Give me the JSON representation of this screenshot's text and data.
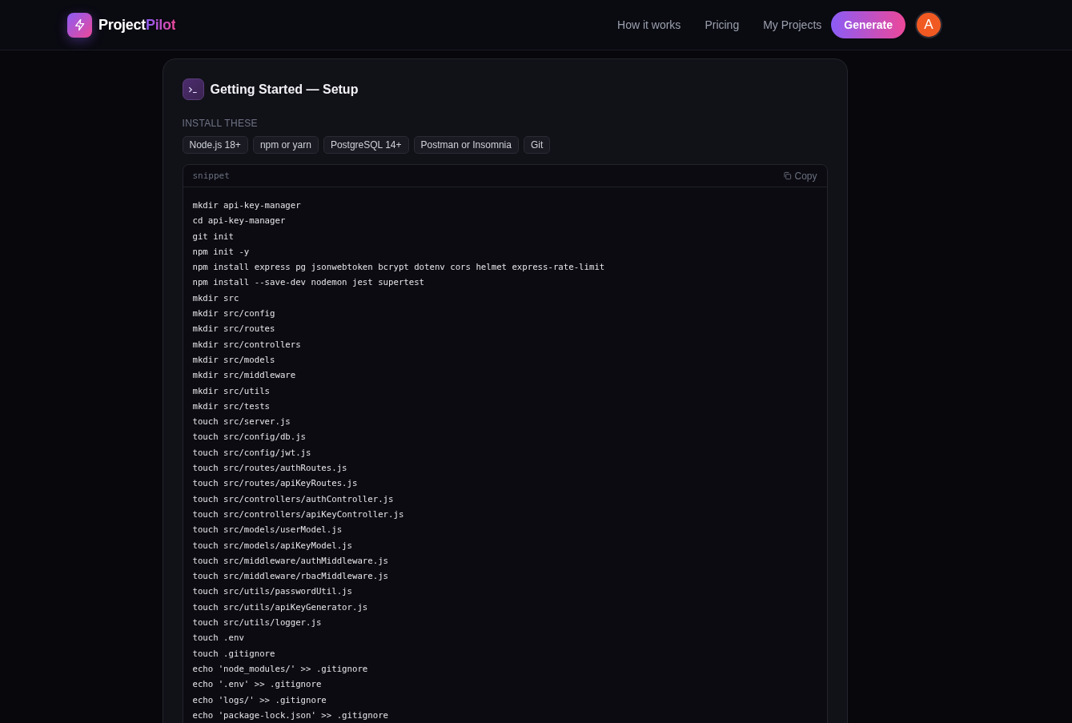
{
  "brand": {
    "name": "Project",
    "accent": "Pilot"
  },
  "nav": [
    {
      "label": "How it works"
    },
    {
      "label": "Pricing"
    },
    {
      "label": "My Projects"
    }
  ],
  "cta": {
    "label": "Generate"
  },
  "avatar": {
    "initial": "A"
  },
  "section": {
    "title": "Getting Started — Setup",
    "install_label": "INSTALL THESE",
    "tools": [
      "Node.js 18+",
      "npm or yarn",
      "PostgreSQL 14+",
      "Postman or Insomnia",
      "Git"
    ],
    "snippet": {
      "label": "snippet",
      "copy": "Copy",
      "lines": [
        "mkdir api-key-manager",
        "cd api-key-manager",
        "git init",
        "npm init -y",
        "npm install express pg jsonwebtoken bcrypt dotenv cors helmet express-rate-limit",
        "npm install --save-dev nodemon jest supertest",
        "mkdir src",
        "mkdir src/config",
        "mkdir src/routes",
        "mkdir src/controllers",
        "mkdir src/models",
        "mkdir src/middleware",
        "mkdir src/utils",
        "mkdir src/tests",
        "touch src/server.js",
        "touch src/config/db.js",
        "touch src/config/jwt.js",
        "touch src/routes/authRoutes.js",
        "touch src/routes/apiKeyRoutes.js",
        "touch src/controllers/authController.js",
        "touch src/controllers/apiKeyController.js",
        "touch src/models/userModel.js",
        "touch src/models/apiKeyModel.js",
        "touch src/middleware/authMiddleware.js",
        "touch src/middleware/rbacMiddleware.js",
        "touch src/utils/passwordUtil.js",
        "touch src/utils/apiKeyGenerator.js",
        "touch src/utils/logger.js",
        "touch .env",
        "touch .gitignore",
        "echo 'node_modules/' >> .gitignore",
        "echo '.env' >> .gitignore",
        "echo 'logs/' >> .gitignore",
        "echo 'package-lock.json' >> .gitignore"
      ]
    }
  }
}
